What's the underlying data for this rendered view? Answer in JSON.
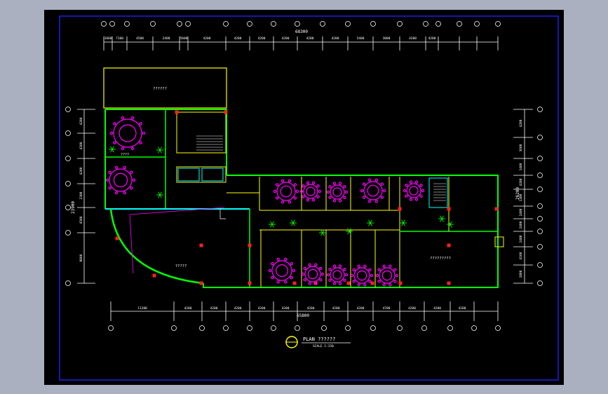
{
  "title": {
    "main": "PLAN ??????",
    "scale": "SCALE 1:150"
  },
  "dims": {
    "top_total": "68300",
    "top": [
      "1000",
      "7100",
      "4500",
      "2400",
      "5600",
      "4200",
      "4200",
      "4200",
      "4200",
      "4200",
      "4200",
      "5400",
      "3000",
      "4200",
      "4200"
    ],
    "bottom_total": "65800",
    "bottom": [
      "11200",
      "4200",
      "4200",
      "4200",
      "4200",
      "4200",
      "4200",
      "4200",
      "4200",
      "4700",
      "4200",
      "4200",
      "4200"
    ],
    "left_total": "23900",
    "left": [
      "4200",
      "4200",
      "4200",
      "2300",
      "4500",
      "8000"
    ],
    "right_total": "26200",
    "right": [
      "4200",
      "3600",
      "1400",
      "4200",
      "1300",
      "2400",
      "2400",
      "2400",
      "4100",
      "1800"
    ]
  },
  "rooms": {
    "top_hall": "??????",
    "round_room": "????",
    "hall": "?????",
    "hall2": "?????????"
  },
  "colors": {
    "bg": "#000000",
    "wall": "#00ff00",
    "yellow": "#ffff00",
    "magenta": "#ff00ff",
    "cyan": "#00ffff",
    "red": "#ff0000",
    "white": "#ffffff",
    "blue": "#2020ff"
  }
}
